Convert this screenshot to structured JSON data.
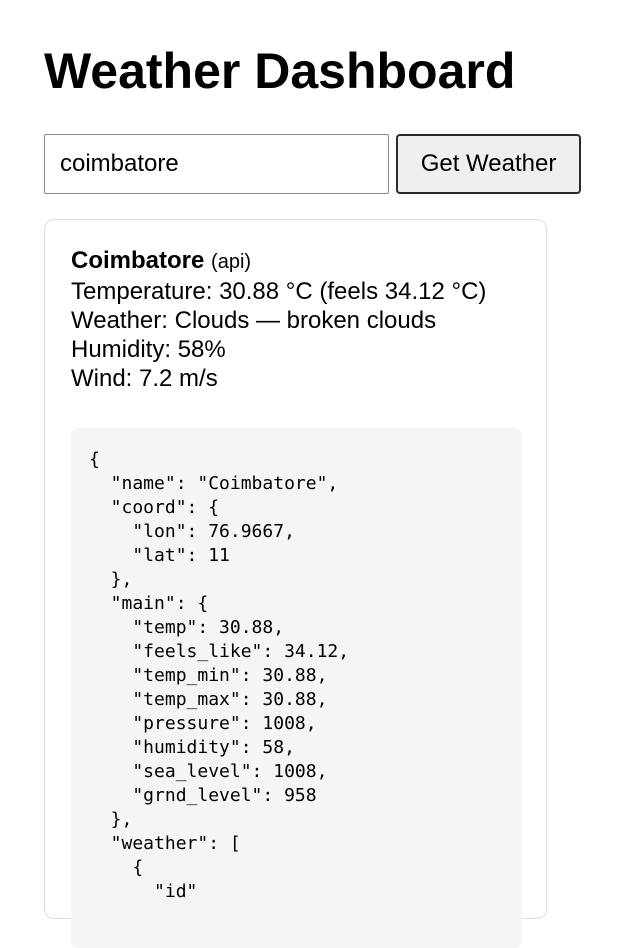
{
  "header": {
    "title": "Weather Dashboard"
  },
  "search": {
    "value": "coimbatore",
    "button_label": "Get Weather"
  },
  "result": {
    "city": "Coimbatore",
    "source": "(api)",
    "temperature_line": "Temperature: 30.88 °C (feels 34.12 °C)",
    "weather_line": "Weather: Clouds — broken clouds",
    "humidity_line": "Humidity: 58%",
    "wind_line": "Wind: 7.2 m/s",
    "raw_json": "{\n  \"name\": \"Coimbatore\",\n  \"coord\": {\n    \"lon\": 76.9667,\n    \"lat\": 11\n  },\n  \"main\": {\n    \"temp\": 30.88,\n    \"feels_like\": 34.12,\n    \"temp_min\": 30.88,\n    \"temp_max\": 30.88,\n    \"pressure\": 1008,\n    \"humidity\": 58,\n    \"sea_level\": 1008,\n    \"grnd_level\": 958\n  },\n  \"weather\": [\n    {\n      \"id\""
  }
}
